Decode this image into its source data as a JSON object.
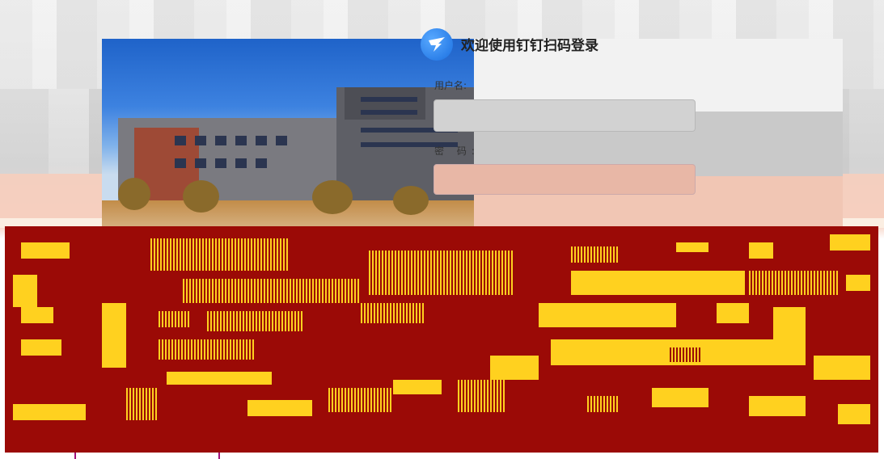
{
  "login": {
    "title": "欢迎使用钉钉扫码登录",
    "username_label": "用户名:",
    "password_label": "密 码:",
    "username_value": "",
    "password_value": ""
  },
  "colors": {
    "glitch_bg": "#9b0a06",
    "glitch_fg": "#ffd11f",
    "logo": "#1a6fe0"
  },
  "icons": {
    "logo": "dingtalk-logo-icon"
  }
}
